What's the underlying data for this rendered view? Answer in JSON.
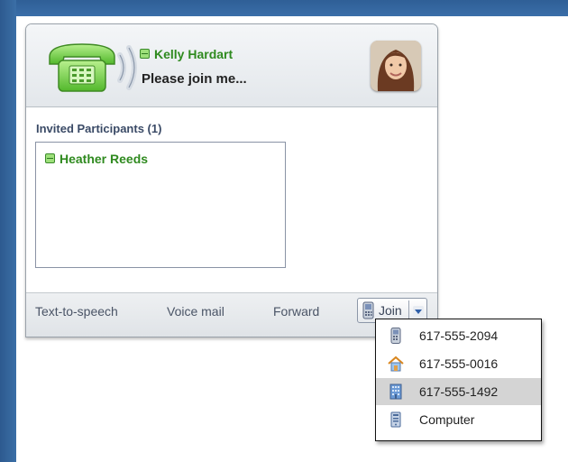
{
  "caller": {
    "name": "Kelly Hardart",
    "message": "Please join me..."
  },
  "participants": {
    "header": "Invited Participants (1)",
    "items": [
      {
        "name": "Heather Reeds"
      }
    ]
  },
  "footer": {
    "text_to_speech": "Text-to-speech",
    "voice_mail": "Voice mail",
    "forward": "Forward",
    "join": "Join"
  },
  "join_menu": {
    "items": [
      {
        "label": "617-555-2094",
        "icon": "mobile-phone-icon"
      },
      {
        "label": "617-555-0016",
        "icon": "home-icon"
      },
      {
        "label": "617-555-1492",
        "icon": "office-building-icon",
        "selected": true
      },
      {
        "label": "Computer",
        "icon": "computer-icon"
      }
    ]
  },
  "colors": {
    "online_green": "#2f8a1f",
    "label_blue": "#3a4a66",
    "desktop_blue": "#3a6ea8"
  }
}
